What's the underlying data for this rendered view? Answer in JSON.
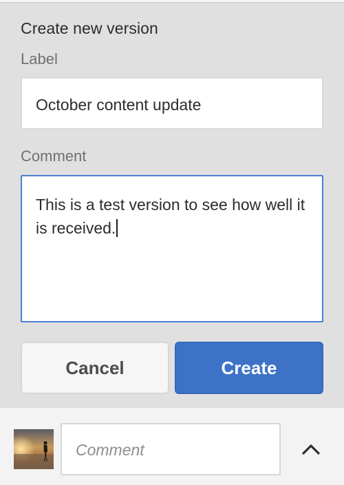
{
  "panel": {
    "title": "Create new version"
  },
  "label_field": {
    "label": "Label",
    "value": "October content update"
  },
  "comment_field": {
    "label": "Comment",
    "value": "This is a test version to see how well it is received."
  },
  "buttons": {
    "cancel": "Cancel",
    "create": "Create"
  },
  "footer": {
    "comment_placeholder": "Comment",
    "avatar_icon": "user-avatar-photo",
    "expand_icon": "chevron-up-icon"
  },
  "colors": {
    "accent": "#3d72c7",
    "focus_border": "#4a7fd1",
    "panel_bg": "#e0e0e0"
  }
}
